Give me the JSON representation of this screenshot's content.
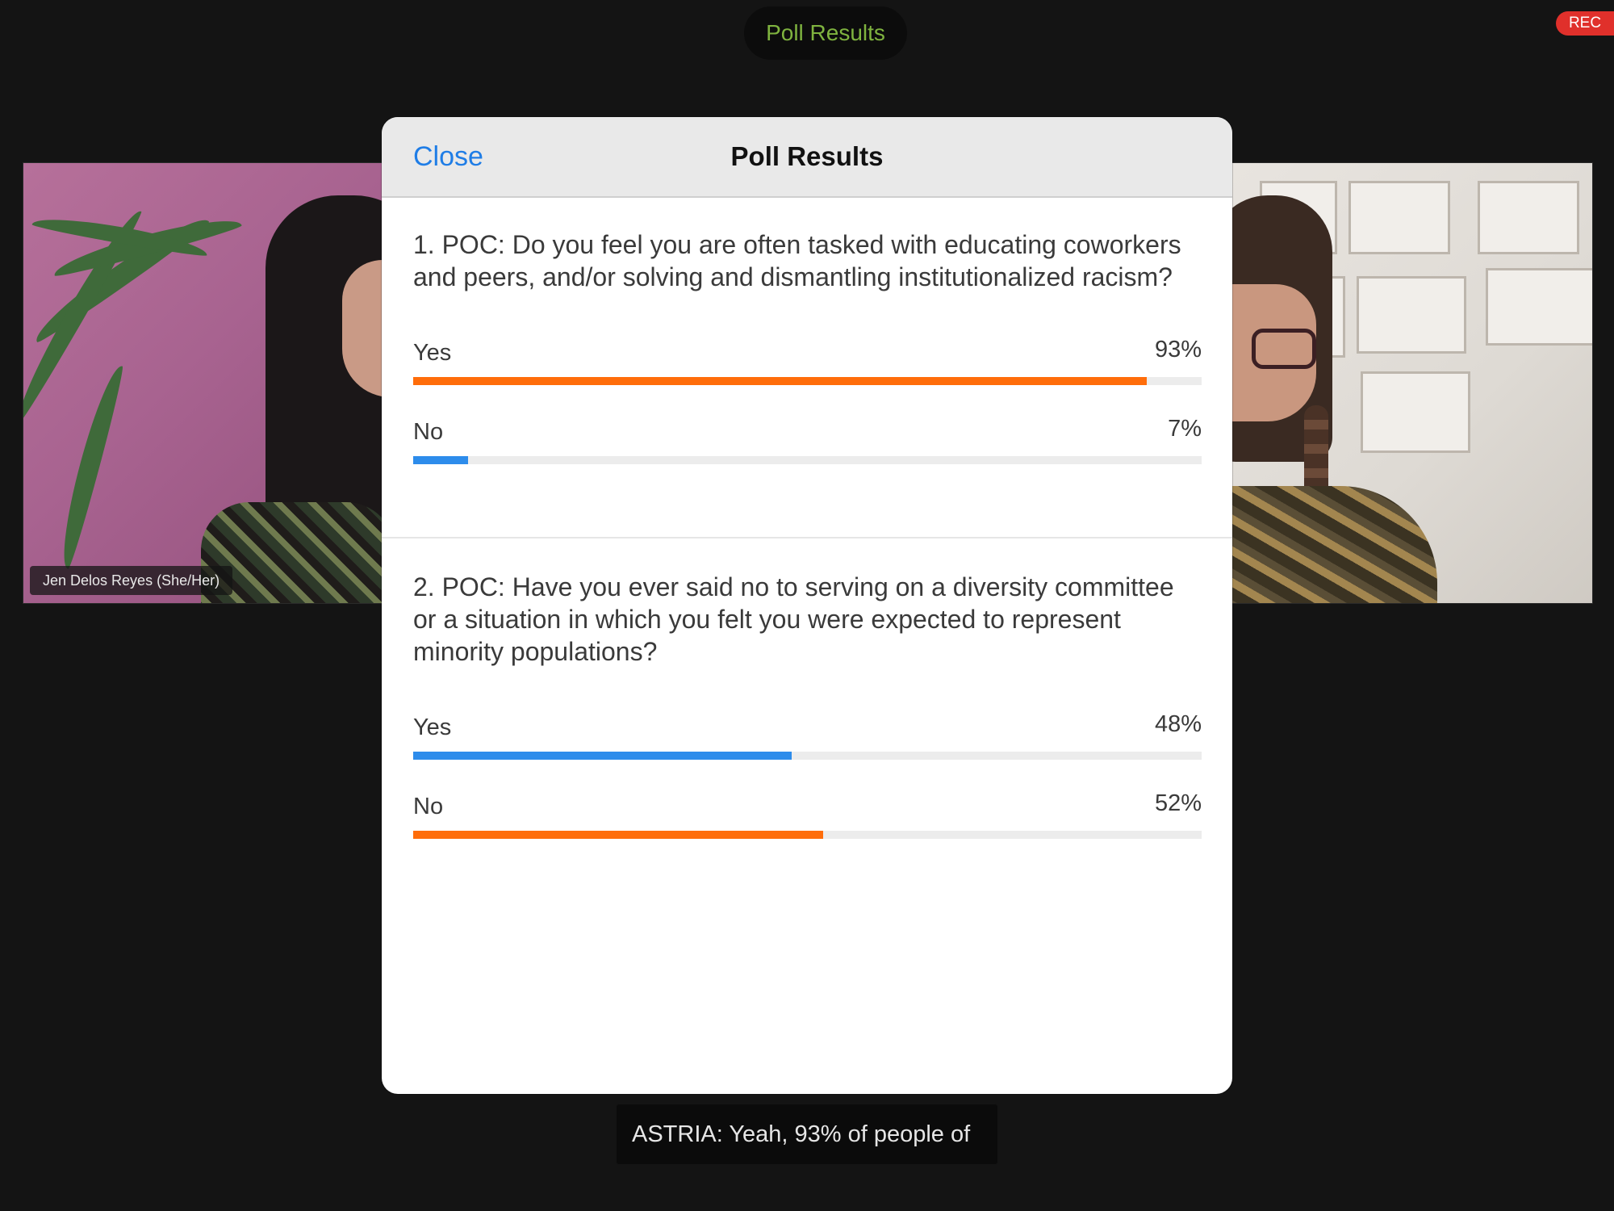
{
  "top_bar": {
    "title": "Poll Results"
  },
  "rec_badge": "REC",
  "participants": {
    "left": {
      "name": "Jen Delos Reyes (She/Her)"
    }
  },
  "modal": {
    "close_label": "Close",
    "title": "Poll Results",
    "questions": [
      {
        "text": "1. POC: Do you feel you are often tasked with educating coworkers and peers, and/or solving and dismantling institutionalized racism?",
        "options": [
          {
            "label": "Yes",
            "percent_text": "93%",
            "percent": 93,
            "color": "#ff6d0a"
          },
          {
            "label": "No",
            "percent_text": "7%",
            "percent": 7,
            "color": "#2d8ceb"
          }
        ]
      },
      {
        "text": "2. POC: Have you ever said no to serving on a diversity committee or a situation in which you felt you were expected to represent minority populations?",
        "options": [
          {
            "label": "Yes",
            "percent_text": "48%",
            "percent": 48,
            "color": "#2d8ceb"
          },
          {
            "label": "No",
            "percent_text": "52%",
            "percent": 52,
            "color": "#ff6d0a"
          }
        ]
      }
    ]
  },
  "caption": "ASTRIA: Yeah, 93% of people of"
}
